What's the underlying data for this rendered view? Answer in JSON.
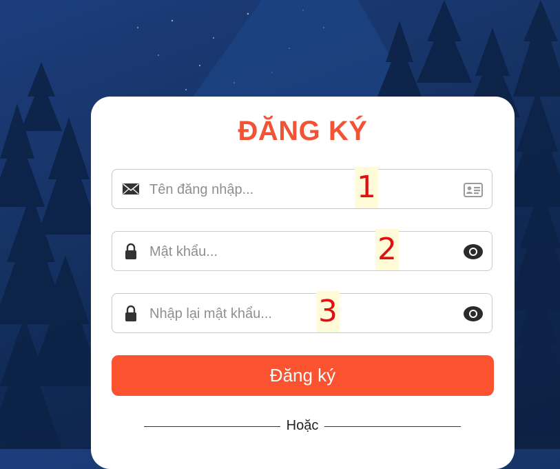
{
  "form": {
    "title": "ĐĂNG KÝ",
    "username": {
      "placeholder": "Tên đăng nhập...",
      "marker": "1"
    },
    "password": {
      "placeholder": "Mật khẩu...",
      "marker": "2"
    },
    "confirm_password": {
      "placeholder": "Nhập lại mật khẩu...",
      "marker": "3"
    },
    "submit_label": "Đăng ký",
    "divider_label": "Hoặc"
  },
  "icons": {
    "username_left": "envelope-icon",
    "username_right": "id-card-icon",
    "password_left": "lock-icon",
    "password_right": "eye-icon",
    "confirm_left": "lock-icon",
    "confirm_right": "eye-icon"
  },
  "colors": {
    "accent": "#fb522f",
    "title": "#f25335",
    "marker_text": "#e01010",
    "marker_bg": "#fffbd9"
  }
}
